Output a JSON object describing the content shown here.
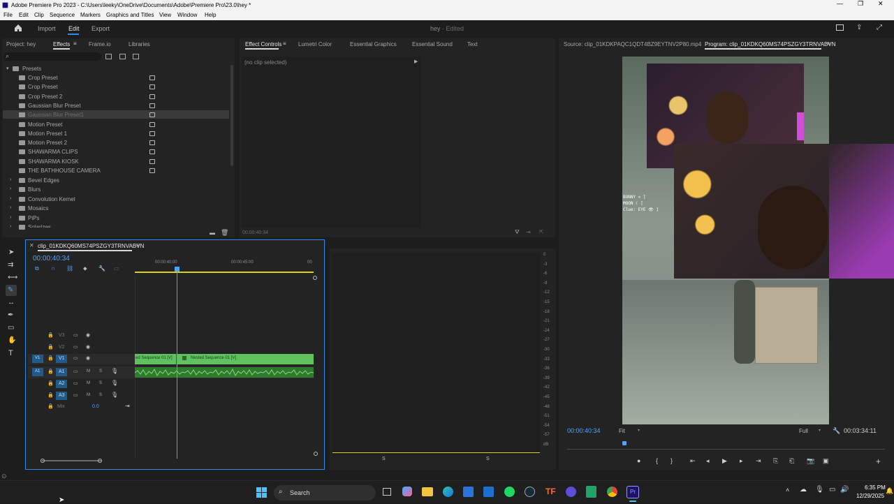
{
  "titlebar": {
    "title": "Adobe Premiere Pro 2023 - C:\\Users\\leeky\\OneDrive\\Documents\\Adobe\\Premiere Pro\\23.0\\hey *"
  },
  "menu": [
    "File",
    "Edit",
    "Clip",
    "Sequence",
    "Markers",
    "Graphics and Titles",
    "View",
    "Window",
    "Help"
  ],
  "workspace": {
    "tabs": [
      "Import",
      "Edit",
      "Export"
    ],
    "active": "Edit",
    "project_name": "hey",
    "project_status": "- Edited"
  },
  "project_panel": {
    "tabs": [
      "Project: hey",
      "Effects",
      "Frame.io",
      "Libraries"
    ],
    "root": "Presets",
    "presets": [
      "Crop Preset",
      "Crop Preset",
      "Crop Preset 2",
      "Gaussian Blur Preset",
      "Gaussian Blur Preset1",
      "Motion Preset",
      "Motion Preset 1",
      "Motion Preset 2",
      "SHAWARMA CLIPS",
      "SHAWARMA KIOSK",
      "THE BATHHOUSE CAMERA"
    ],
    "folders": [
      "Bevel Edges",
      "Blurs",
      "Convolution Kernel",
      "Mosaics",
      "PiPs",
      "Solarizes"
    ]
  },
  "effect_controls": {
    "tabs": [
      "Effect Controls",
      "Lumetri Color",
      "Essential Graphics",
      "Essential Sound",
      "Text"
    ],
    "no_clip": "(no clip selected)",
    "timecode": "00:00:40:34"
  },
  "source": {
    "title": "Source: clip_01KDKPAQC1QDT4BZ9EYTNV2P80.mp4"
  },
  "program": {
    "title": "Program: clip_01KDKQ60MS74PSZGY3TRNVABVN",
    "timecode": "00:00:40:34",
    "fit": "Fit",
    "quality": "Full",
    "duration": "00:03:34:11",
    "overlay_text": [
      "BUNNY ✕ ]",
      "MOON ☾ [",
      "Clue: EYE 👁 ]"
    ]
  },
  "timeline": {
    "title": "clip_01KDKQ60MS74PSZGY3TRNVABVN",
    "timecode": "00:00:40:34",
    "ruler": [
      "00:00:40:00",
      "00:00:45:00",
      "00"
    ],
    "video_tracks": [
      "V3",
      "V2",
      "V1"
    ],
    "audio_tracks": [
      "A1",
      "A2",
      "A3"
    ],
    "mix_label": "Mix",
    "mix_value": "0.0",
    "clip_a": "ed Sequence 01 [V]",
    "clip_b": "Nested Sequence 01 [V]"
  },
  "meter": {
    "labels": [
      "0",
      "-3",
      "-6",
      "-9",
      "-12",
      "-15",
      "-18",
      "-21",
      "-24",
      "-27",
      "-30",
      "-33",
      "-36",
      "-39",
      "-42",
      "-45",
      "-48",
      "-51",
      "-54",
      "-57",
      "dB"
    ],
    "bottom": [
      "S",
      "S"
    ]
  },
  "taskbar": {
    "search": "Search",
    "time": "6:35 PM",
    "date": "12/29/2025"
  },
  "colors": {
    "accent_blue": "#2d8ceb",
    "clip_green": "#5fc25f",
    "timecode_blue": "#4fa3ff"
  }
}
